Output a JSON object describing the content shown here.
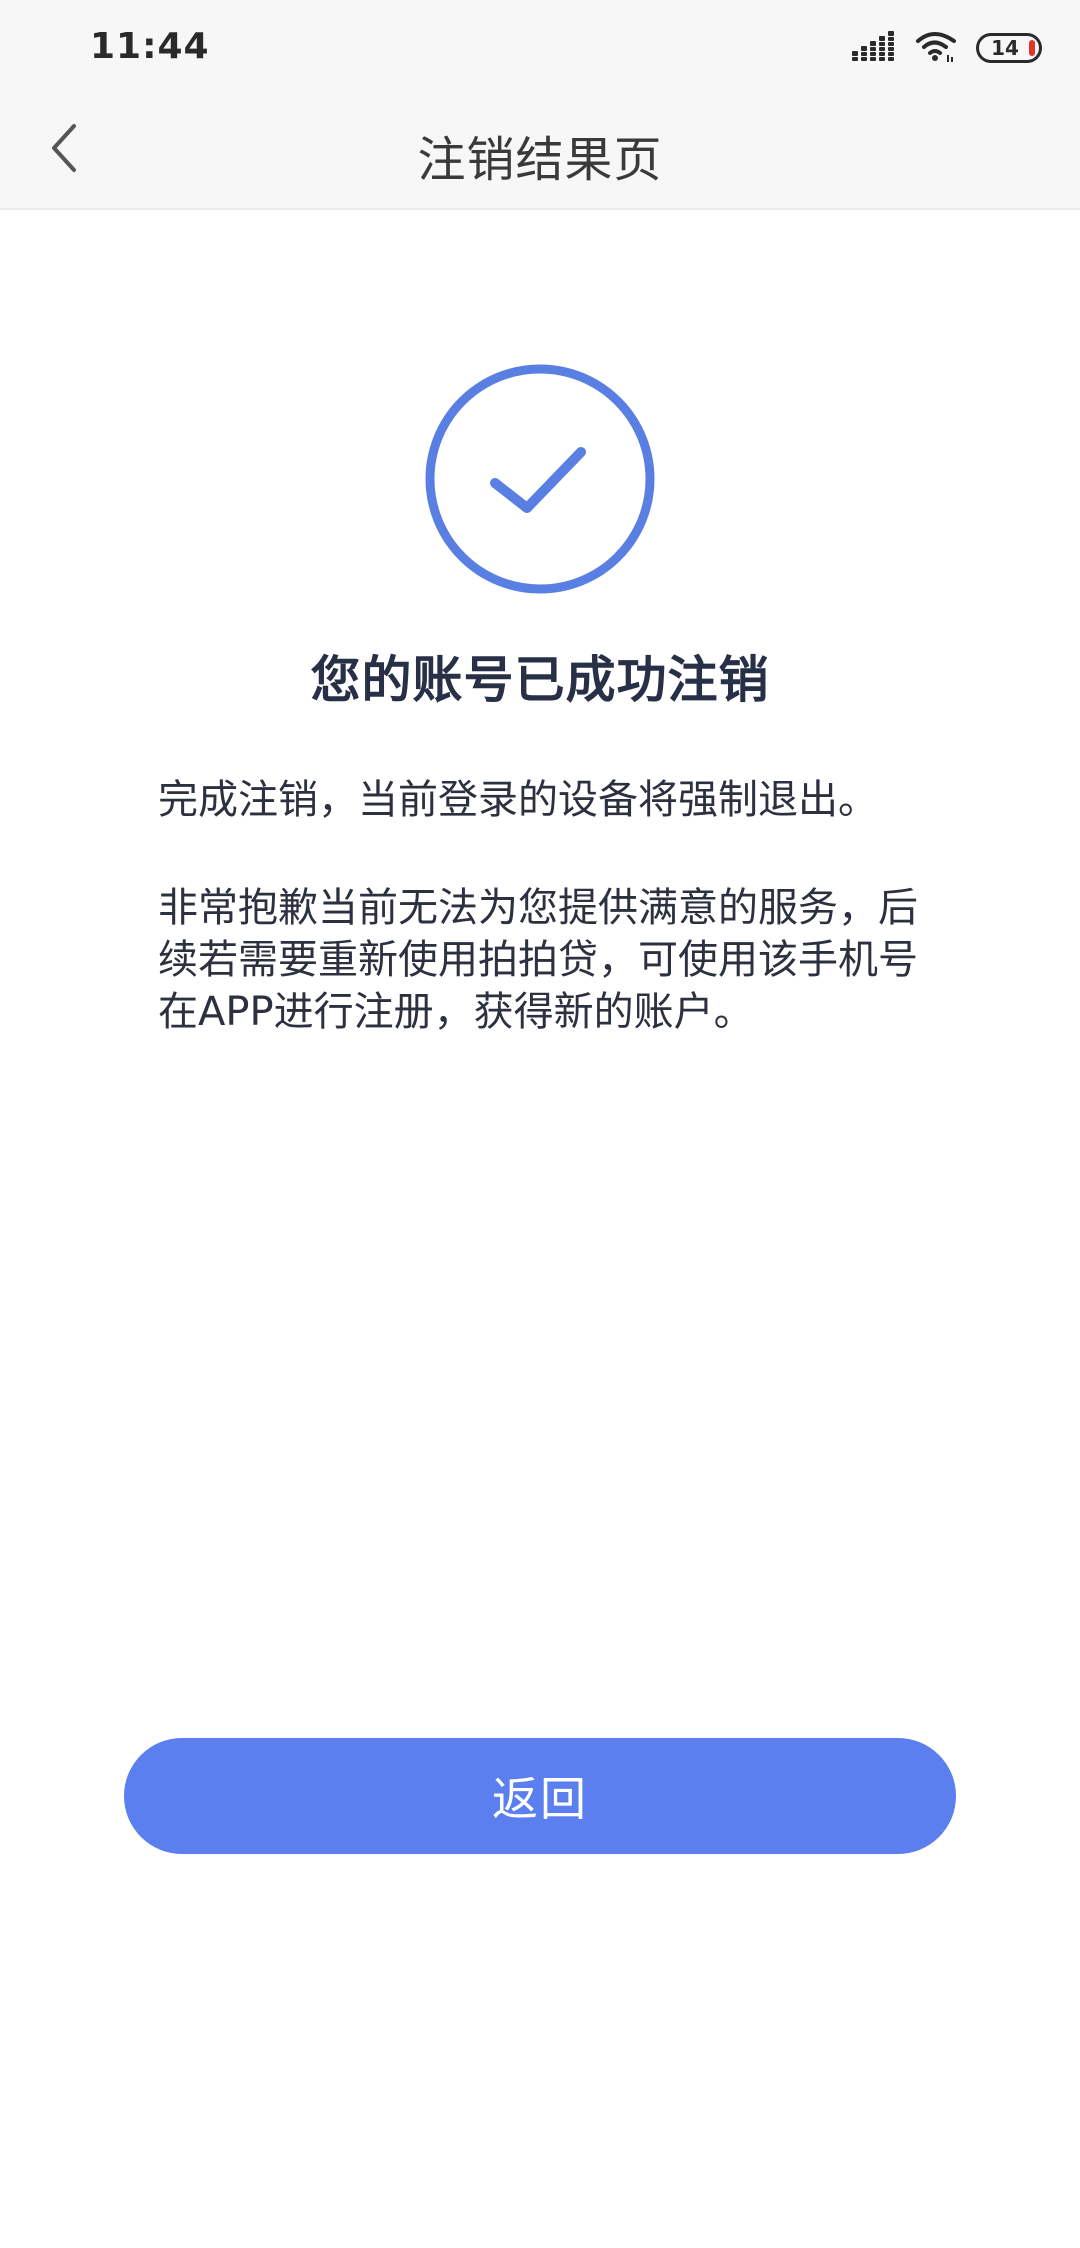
{
  "status_bar": {
    "time": "11:44",
    "battery": "14",
    "icons": [
      "signal-icon",
      "wifi-icon",
      "battery-icon"
    ]
  },
  "nav": {
    "title": "注销结果页",
    "back_icon": "chevron-left-icon"
  },
  "result": {
    "icon": "check-circle-icon",
    "title": "您的账号已成功注销",
    "message_1": "完成注销，当前登录的设备将强制退出。",
    "message_2": "非常抱歉当前无法为您提供满意的服务，后续若需要重新使用拍拍贷，可使用该手机号在APP进行注册，获得新的账户。"
  },
  "actions": {
    "return_label": "返回"
  },
  "colors": {
    "accent": "#5b7fee",
    "check": "#5a7fe3",
    "battery_low": "#e2342c",
    "title": "#273046"
  }
}
